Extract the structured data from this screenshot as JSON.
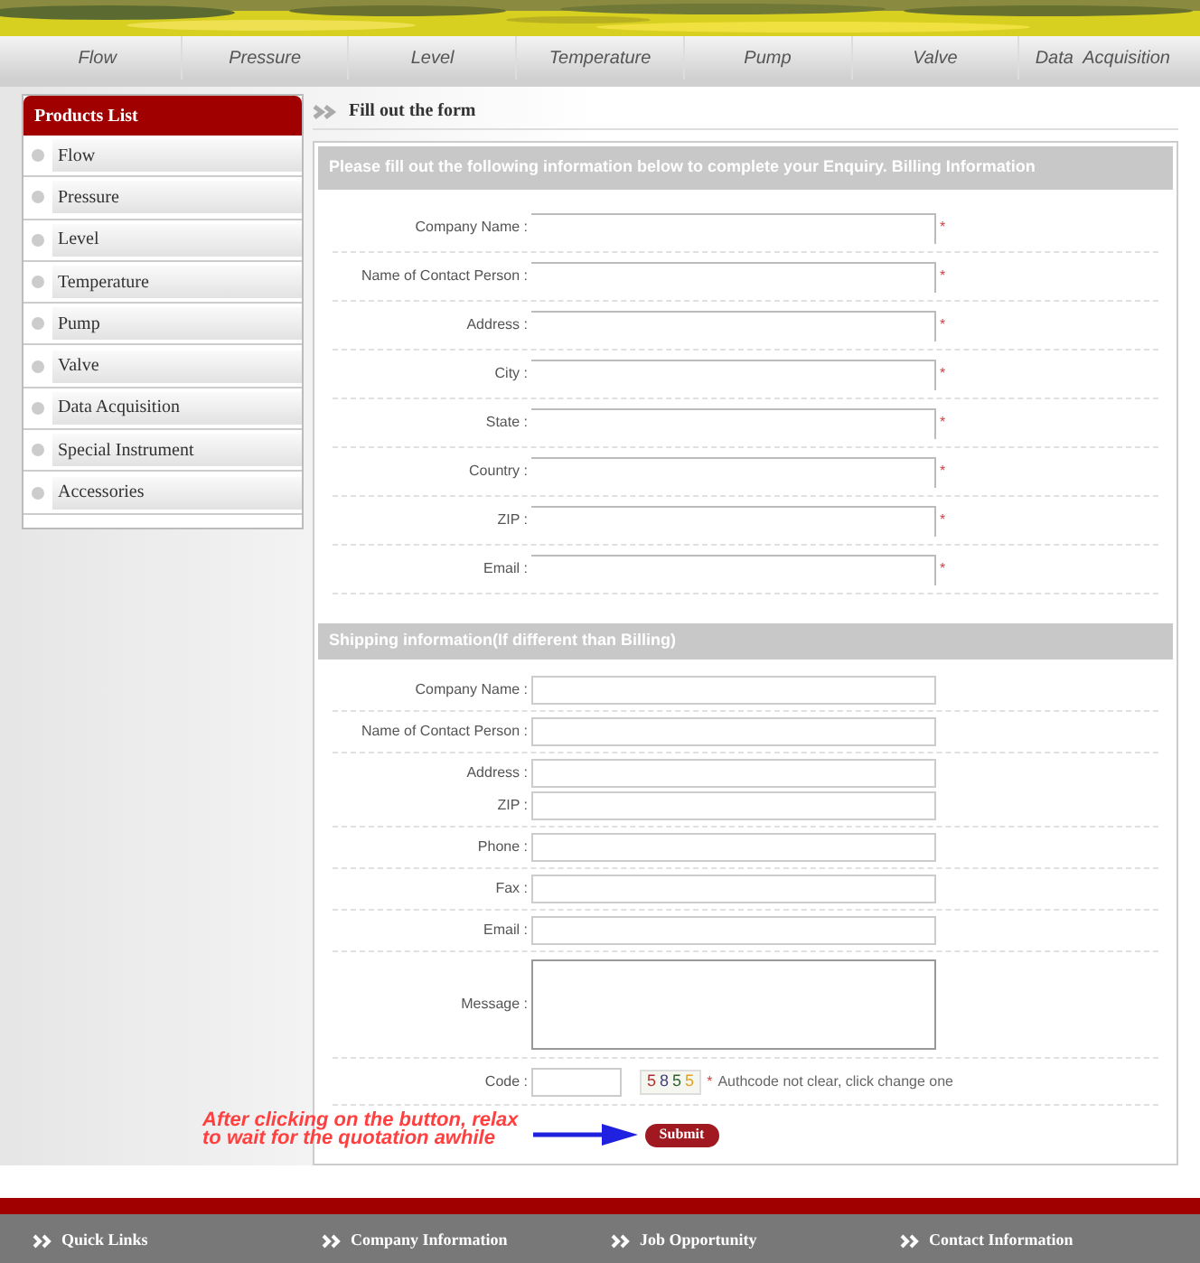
{
  "nav": [
    {
      "label": "Flow"
    },
    {
      "label": "Pressure"
    },
    {
      "label": "Level"
    },
    {
      "label": "Temperature"
    },
    {
      "label": "Pump"
    },
    {
      "label": "Valve"
    },
    {
      "label": "Data  Acquisition"
    }
  ],
  "sidebar": {
    "title": "Products List",
    "items": [
      "Flow",
      "Pressure",
      "Level",
      "Temperature",
      "Pump",
      "Valve",
      "Data Acquisition",
      "Special Instrument",
      "Accessories"
    ]
  },
  "page_title": "Fill out the form",
  "billing": {
    "heading": "Please fill out the following information below to complete your Enquiry. Billing Information",
    "required_mark": "*",
    "fields": [
      {
        "label": "Company Name :"
      },
      {
        "label": "Name of Contact Person :"
      },
      {
        "label": "Address :"
      },
      {
        "label": "City :"
      },
      {
        "label": "State :"
      },
      {
        "label": "Country :"
      },
      {
        "label": "ZIP :"
      },
      {
        "label": "Email :"
      }
    ]
  },
  "shipping": {
    "heading": "Shipping information(If different than Billing)",
    "rows": [
      [
        {
          "label": "Company Name :",
          "kind": "text"
        }
      ],
      [
        {
          "label": "Name of Contact Person :",
          "kind": "text"
        }
      ],
      [
        {
          "label": "Address :",
          "kind": "text"
        },
        {
          "label": "ZIP :",
          "kind": "text"
        }
      ],
      [
        {
          "label": "Phone :",
          "kind": "text"
        }
      ],
      [
        {
          "label": "Fax :",
          "kind": "text"
        }
      ],
      [
        {
          "label": "Email :",
          "kind": "text"
        }
      ],
      [
        {
          "label": "Message :",
          "kind": "textarea"
        }
      ]
    ],
    "code": {
      "label": "Code :",
      "captcha": [
        {
          "digit": "5",
          "color": "#b03030"
        },
        {
          "digit": "8",
          "color": "#404080"
        },
        {
          "digit": "5",
          "color": "#306030"
        },
        {
          "digit": "5",
          "color": "#e0a020"
        }
      ],
      "required_mark": "*",
      "hint": "Authcode not clear, click change one"
    }
  },
  "note": [
    "After clicking on the button, relax",
    "to wait for the quotation awhile"
  ],
  "submit": "Submit",
  "footer": [
    "Quick Links",
    "Company Information",
    "Job Opportunity",
    "Contact Information"
  ]
}
